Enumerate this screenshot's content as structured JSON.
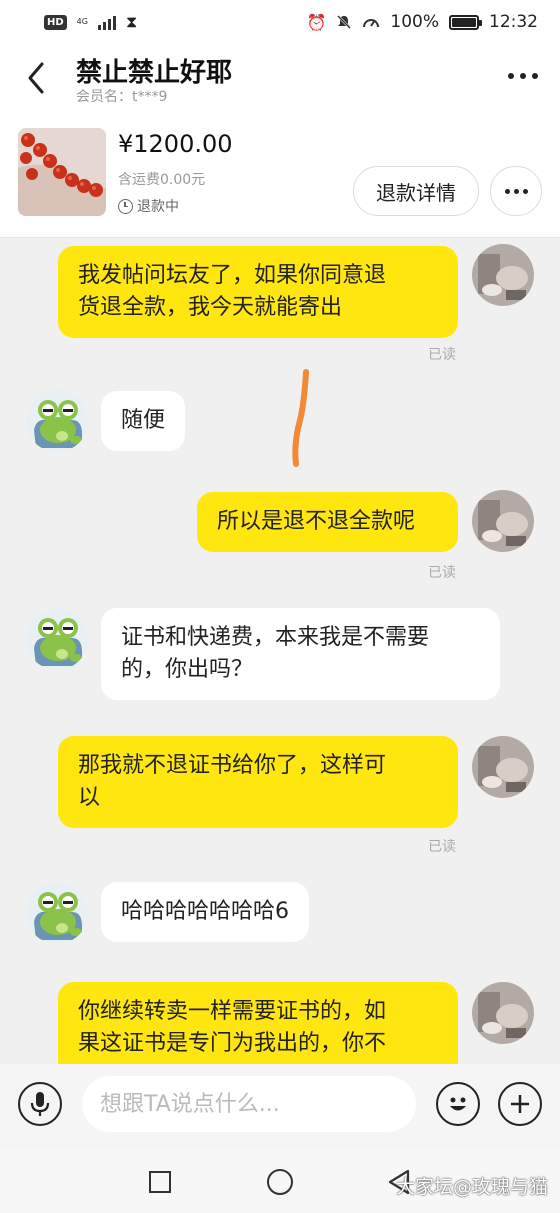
{
  "status_bar": {
    "hd": "HD",
    "network": "4G",
    "battery": "100%",
    "battery_level": 1.0,
    "time": "12:32"
  },
  "header": {
    "title": "禁止禁止好耶",
    "member": "会员名：t***9"
  },
  "product": {
    "price": "¥1200.00",
    "shipping": "含运费0.00元",
    "status": "退款中",
    "refund_button": "退款详情"
  },
  "messages": [
    {
      "side": "me",
      "lines": [
        "我发帖问坛友了，如果你同意退",
        "货退全款，我今天就能寄出"
      ],
      "receipt": "已读"
    },
    {
      "side": "them",
      "lines": [
        "随便"
      ]
    },
    {
      "side": "me",
      "lines": [
        "所以是退不退全款呢"
      ],
      "receipt": "已读"
    },
    {
      "side": "them",
      "lines": [
        "证书和快递费，本来我是不需要",
        "的，你出吗？"
      ]
    },
    {
      "side": "me",
      "lines": [
        "那我就不退证书给你了，这样可",
        "以"
      ],
      "receipt": "已读"
    },
    {
      "side": "them",
      "lines": [
        "哈哈哈哈哈哈哈6"
      ]
    },
    {
      "side": "me",
      "lines": [
        "你继续转卖一样需要证书的，如",
        "果这证书是专门为我出的，你不"
      ]
    }
  ],
  "input": {
    "placeholder": "想跟TA说点什么..."
  },
  "watermark": "大家坛@玫瑰与猫",
  "colors": {
    "my_bubble": "#ffe60f",
    "their_bubble": "#ffffff",
    "background": "#f0f0f0",
    "annotation_stroke": "#f08a35"
  },
  "icons": [
    "back-icon",
    "more-icon",
    "clock-icon",
    "mic-icon",
    "emoji-icon",
    "plus-icon",
    "nav-square-icon",
    "nav-home-icon",
    "nav-back-icon"
  ]
}
